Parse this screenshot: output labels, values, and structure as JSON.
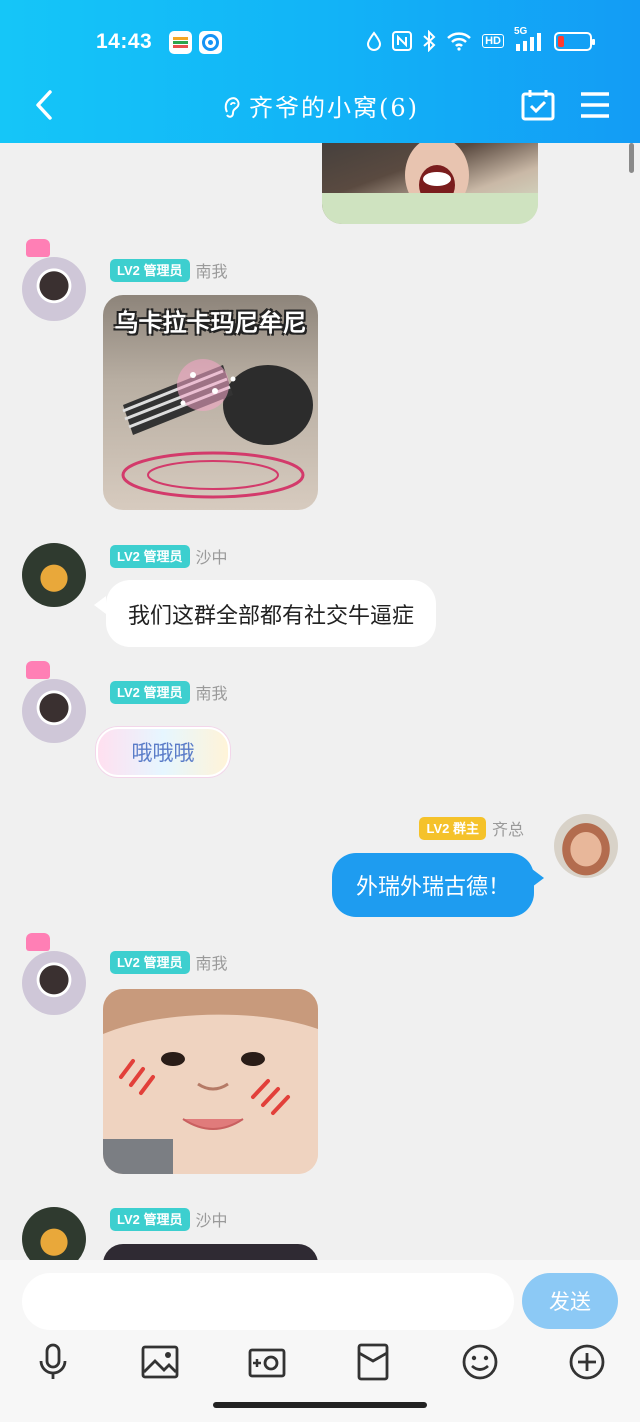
{
  "status_bar": {
    "time": "14:43",
    "hd": "HD",
    "network": "5G",
    "battery_level": 0.2,
    "battery_color": "#ff3b30"
  },
  "header": {
    "title": "齐爷的小窝(6)",
    "icons": [
      "back-arrow-icon",
      "calendar-check-icon",
      "menu-icon"
    ],
    "gradient": [
      "#15c6f8",
      "#139cf5"
    ]
  },
  "messages": [
    {
      "type": "sticker",
      "side": "left",
      "sender_badge": "LV2 管理员",
      "sender": "南我",
      "caption": "乌卡拉卡玛尼牟尼",
      "avatar": "nan"
    },
    {
      "type": "text",
      "side": "left",
      "sender_badge": "LV2 管理员",
      "sender": "沙中",
      "text": "我们这群全部都有社交牛逼症",
      "avatar": "sha"
    },
    {
      "type": "decorated-text",
      "side": "left",
      "sender_badge": "LV2 管理员",
      "sender": "南我",
      "text": "哦哦哦",
      "avatar": "nan"
    },
    {
      "type": "text",
      "side": "right",
      "sender_badge": "LV2 群主",
      "sender": "齐总",
      "text": "外瑞外瑞古德！",
      "avatar": "qi"
    },
    {
      "type": "sticker",
      "side": "left",
      "sender_badge": "LV2 管理员",
      "sender": "南我",
      "caption": "",
      "avatar": "nan"
    },
    {
      "type": "sticker",
      "side": "left",
      "sender_badge": "LV2 管理员",
      "sender": "沙中",
      "caption": "",
      "avatar": "sha"
    }
  ],
  "input": {
    "value": "",
    "send_label": "发送"
  },
  "toolbar": [
    "microphone-icon",
    "image-icon",
    "camera-icon",
    "red-packet-icon",
    "emoji-icon",
    "plus-icon"
  ],
  "colors": {
    "my_bubble": "#1e9cf0",
    "admin_badge": "#3dcfcf",
    "owner_badge": "#f5c22a",
    "send_button": "#8cc9f5"
  }
}
